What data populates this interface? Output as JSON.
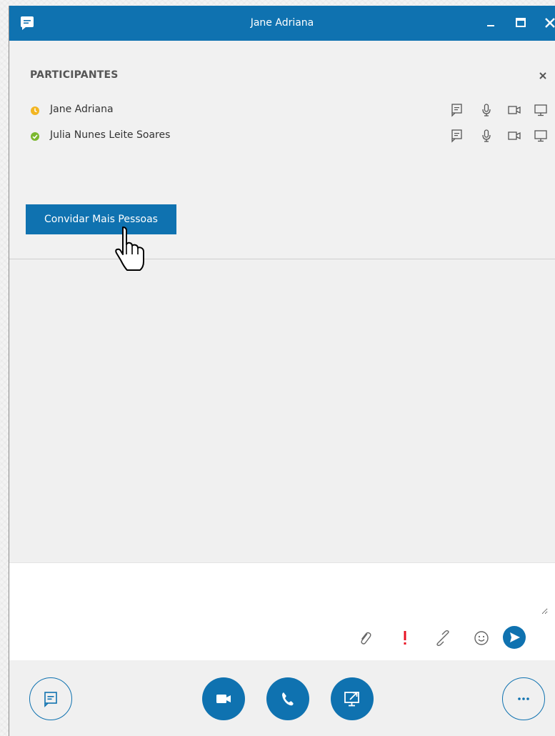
{
  "window": {
    "title": "Jane Adriana"
  },
  "participants": {
    "header": "PARTICIPANTES",
    "list": [
      {
        "name": "Jane Adriana",
        "status": "away",
        "status_color": "#f2b521"
      },
      {
        "name": "Julia Nunes Leite Soares",
        "status": "available",
        "status_color": "#7cb82f"
      }
    ],
    "invite_button": "Convidar Mais Pessoas"
  },
  "compose": {
    "placeholder": ""
  },
  "colors": {
    "accent": "#0f72b0",
    "importance": "#e81123"
  },
  "icons": {
    "row_actions": [
      "chat-icon",
      "microphone-icon",
      "video-icon",
      "screen-share-icon"
    ],
    "compose": [
      "attachment-icon",
      "importance-icon",
      "link-icon",
      "emoji-icon",
      "send-icon"
    ],
    "bottom": [
      "im-icon",
      "video-call-icon",
      "phone-icon",
      "present-icon",
      "more-icon"
    ]
  }
}
